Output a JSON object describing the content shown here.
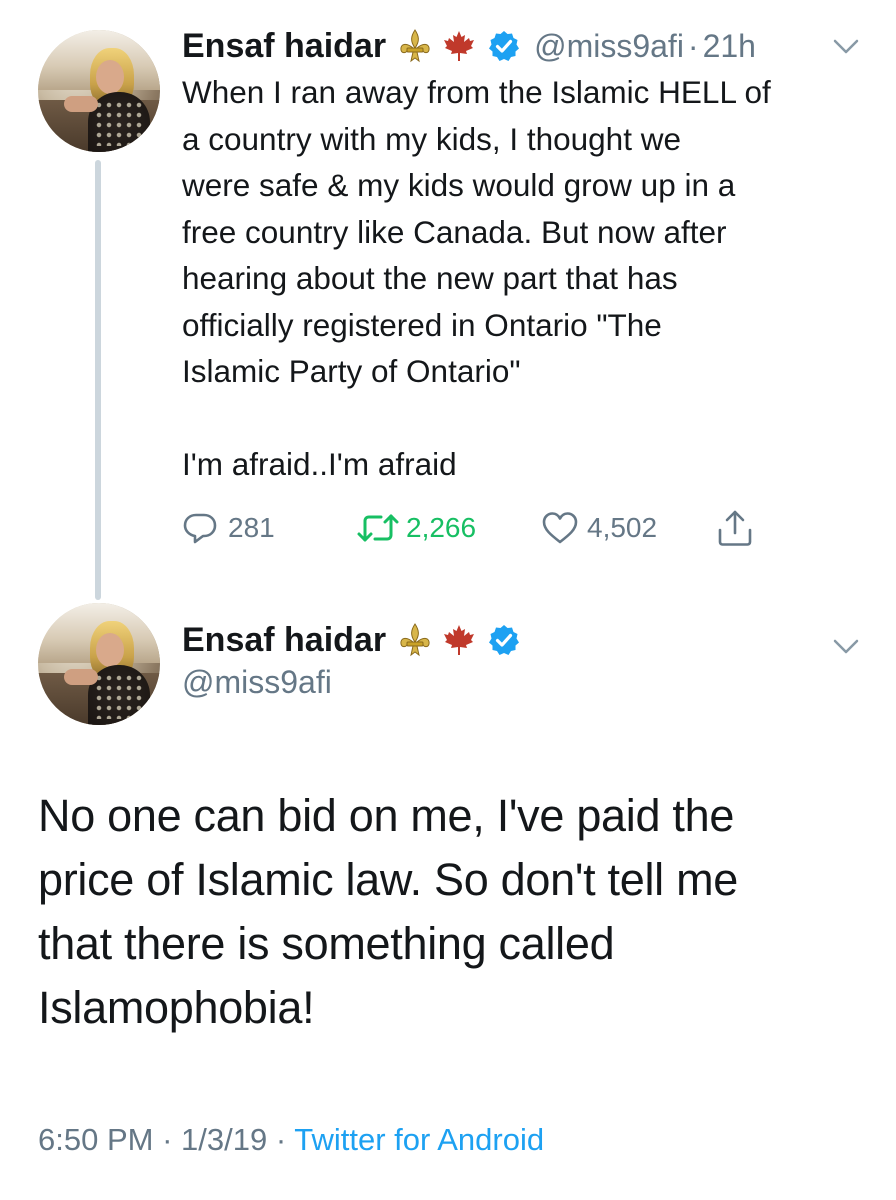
{
  "tweet1": {
    "name": "Ensaf haidar",
    "handle": "@miss9afi",
    "separator": "·",
    "time": "21h",
    "text": "When I ran away from the Islamic HELL of\na country with my kids, I thought we\nwere safe & my kids would grow up in a\nfree country like Canada. But now after\nhearing about the new part that has\nofficially registered in Ontario \"The\nIslamic Party of Ontario\"\n\nI'm afraid..I'm afraid",
    "actions": {
      "replies": "281",
      "retweets": "2,266",
      "likes": "4,502"
    }
  },
  "tweet2": {
    "name": "Ensaf haidar",
    "handle": "@miss9afi",
    "text": "No one can bid on me, I've paid the\nprice of Islamic law. So don't tell me\nthat there is something called\nIslamophobia!",
    "meta": {
      "time": "6:50 PM",
      "separator1": "·",
      "date": "1/3/19",
      "separator2": "·",
      "source": "Twitter for Android"
    }
  },
  "icons": [
    "fleur-de-lis-icon",
    "maple-leaf-icon",
    "verified-badge-icon",
    "chevron-down-icon",
    "reply-icon",
    "retweet-icon",
    "like-icon",
    "share-icon"
  ],
  "colors": {
    "verified": "#1da1f2",
    "retweet": "#17bf63",
    "secondary": "#657786",
    "link": "#1da1f2",
    "maple": "#c0392b",
    "fleur": "#c9a227"
  }
}
